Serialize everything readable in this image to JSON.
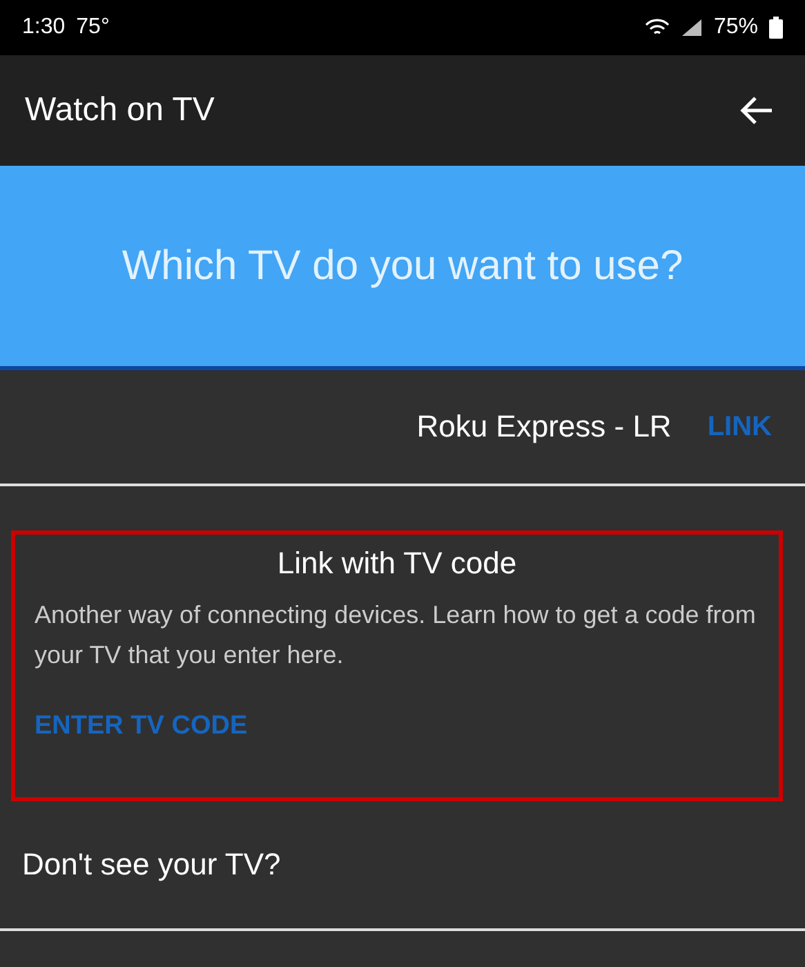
{
  "status_bar": {
    "time": "1:30",
    "temperature": "75°",
    "battery": "75%"
  },
  "app_bar": {
    "title": "Watch on TV"
  },
  "banner": {
    "title": "Which TV do you want to use?"
  },
  "devices": [
    {
      "name": "Roku Express - LR",
      "action": "LINK"
    }
  ],
  "tv_code_card": {
    "title": "Link with TV code",
    "description": "Another way of connecting devices. Learn how to get a code from your TV that you enter here.",
    "button": "ENTER TV CODE"
  },
  "help": {
    "title": "Don't see your TV?"
  }
}
